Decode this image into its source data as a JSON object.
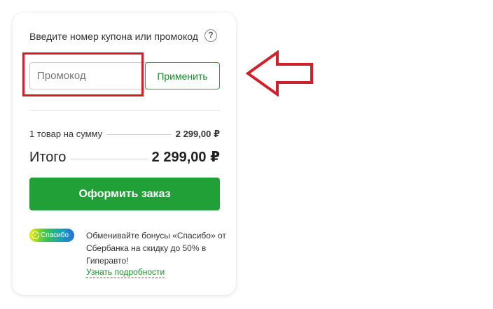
{
  "promo": {
    "label": "Введите номер купона или промокод",
    "help_icon": "question-circle-icon",
    "placeholder": "Промокод",
    "apply_label": "Применить"
  },
  "summary": {
    "items_label": "1 товар на сумму",
    "items_amount": "2 299,00 ₽",
    "total_label": "Итого",
    "total_amount": "2 299,00 ₽"
  },
  "checkout": {
    "order_label": "Оформить заказ"
  },
  "spasibo": {
    "logo_text": "Спасибо",
    "logo_icon": "check-circle-icon",
    "description": "Обменивайте бонусы «Спасибо» от Сбербанка на скидку до 50% в Гиперавто!",
    "link_label": "Узнать подробности"
  },
  "annotations": {
    "arrow_icon": "left-arrow-outline-icon",
    "highlight_color": "#d0202a"
  },
  "colors": {
    "accent": "#21a038",
    "link": "#1a8a30"
  }
}
